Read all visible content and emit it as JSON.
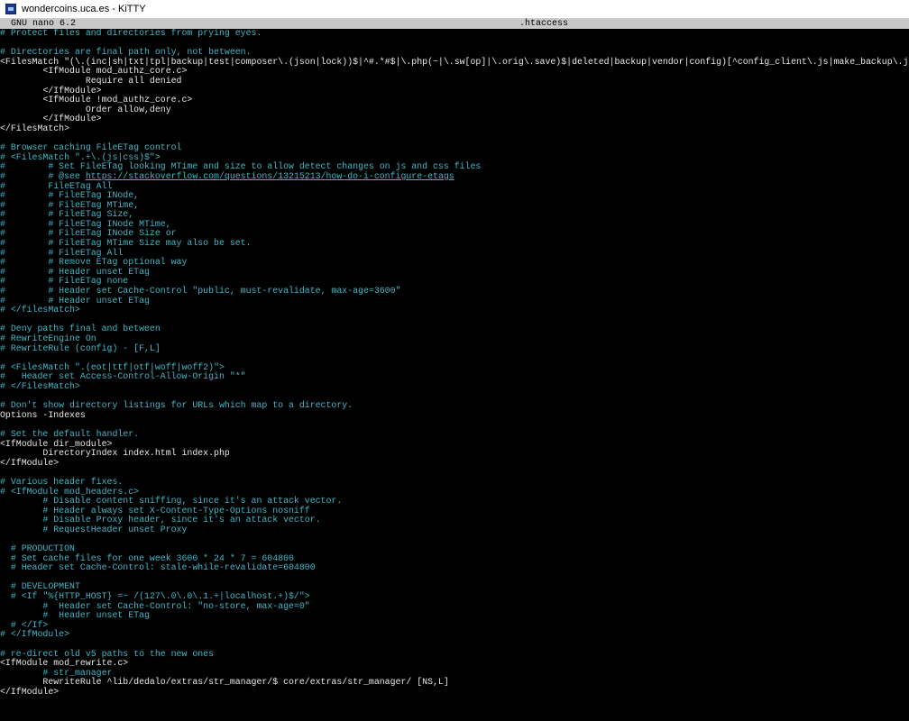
{
  "window": {
    "title": "wondercoins.uca.es - KiTTY",
    "icon": "kitty-terminal-icon"
  },
  "nano": {
    "version": "GNU nano 6.2",
    "filename": ".htaccess"
  },
  "colors": {
    "comment": "#3fb8c8",
    "text": "#e8e8e8",
    "background": "#000000",
    "header_bar": "#c8c8c8"
  },
  "editor": {
    "lines": [
      {
        "text": "# Protect files and directories from prying eyes.",
        "comment": true
      },
      {
        "text": "",
        "comment": false
      },
      {
        "text": "# Directories are final path only, not between.",
        "comment": true
      },
      {
        "text": "<FilesMatch \"(\\.(inc|sh|txt|tpl|backup|test|composer\\.(json|lock))$|^#.*#$|\\.php(~|\\.sw[op]|\\.orig\\.save)$|deleted|backup|vendor|config)[^config_client\\.js|make_backup\\.js]\">",
        "comment": false
      },
      {
        "text": "        <IfModule mod_authz_core.c>",
        "comment": false
      },
      {
        "text": "                Require all denied",
        "comment": false
      },
      {
        "text": "        </IfModule>",
        "comment": false
      },
      {
        "text": "        <IfModule !mod_authz_core.c>",
        "comment": false
      },
      {
        "text": "                Order allow,deny",
        "comment": false
      },
      {
        "text": "        </IfModule>",
        "comment": false
      },
      {
        "text": "</FilesMatch>",
        "comment": false
      },
      {
        "text": "",
        "comment": false
      },
      {
        "text": "# Browser caching FileETag control",
        "comment": true
      },
      {
        "text": "# <FilesMatch \".+\\.(js|css)$\">",
        "comment": true
      },
      {
        "text": "#        # Set FileETag looking MTime and size to allow detect changes on js and css files",
        "comment": true
      },
      {
        "text": "#        # @see ",
        "comment": true,
        "link": "https://stackoverflow.com/questions/13215213/how-do-i-configure-etags"
      },
      {
        "text": "#        FileETag All",
        "comment": true
      },
      {
        "text": "#        # FileETag INode,",
        "comment": true
      },
      {
        "text": "#        # FileETag MTime,",
        "comment": true
      },
      {
        "text": "#        # FileETag Size,",
        "comment": true
      },
      {
        "text": "#        # FileETag INode MTime,",
        "comment": true
      },
      {
        "text": "#        # FileETag INode Size or",
        "comment": true
      },
      {
        "text": "#        # FileETag MTime Size may also be set.",
        "comment": true
      },
      {
        "text": "#        # FileETag All",
        "comment": true
      },
      {
        "text": "#        # Remove ETag optional way",
        "comment": true
      },
      {
        "text": "#        # Header unset ETag",
        "comment": true
      },
      {
        "text": "#        # FileETag none",
        "comment": true
      },
      {
        "text": "#        # Header set Cache-Control \"public, must-revalidate, max-age=3600\"",
        "comment": true
      },
      {
        "text": "#        # Header unset ETag",
        "comment": true
      },
      {
        "text": "# </filesMatch>",
        "comment": true
      },
      {
        "text": "",
        "comment": false
      },
      {
        "text": "# Deny paths final and between",
        "comment": true
      },
      {
        "text": "# RewriteEngine On",
        "comment": true
      },
      {
        "text": "# RewriteRule (config) - [F,L]",
        "comment": true
      },
      {
        "text": "",
        "comment": false
      },
      {
        "text": "# <FilesMatch \".(eot|ttf|otf|woff|woff2)\">",
        "comment": true
      },
      {
        "text": "#   Header set Access-Control-Allow-Origin \"*\"",
        "comment": true
      },
      {
        "text": "# </FilesMatch>",
        "comment": true
      },
      {
        "text": "",
        "comment": false
      },
      {
        "text": "# Don't show directory listings for URLs which map to a directory.",
        "comment": true
      },
      {
        "text": "Options -Indexes",
        "comment": false
      },
      {
        "text": "",
        "comment": false
      },
      {
        "text": "# Set the default handler.",
        "comment": true
      },
      {
        "text": "<IfModule dir_module>",
        "comment": false
      },
      {
        "text": "        DirectoryIndex index.html index.php",
        "comment": false
      },
      {
        "text": "</IfModule>",
        "comment": false
      },
      {
        "text": "",
        "comment": false
      },
      {
        "text": "# Various header fixes.",
        "comment": true
      },
      {
        "text": "# <IfModule mod_headers.c>",
        "comment": true
      },
      {
        "text": "        # Disable content sniffing, since it's an attack vector.",
        "comment": true
      },
      {
        "text": "        # Header always set X-Content-Type-Options nosniff",
        "comment": true
      },
      {
        "text": "        # Disable Proxy header, since it's an attack vector.",
        "comment": true
      },
      {
        "text": "        # RequestHeader unset Proxy",
        "comment": true
      },
      {
        "text": "",
        "comment": false
      },
      {
        "text": "  # PRODUCTION",
        "comment": true
      },
      {
        "text": "  # Set cache files for one week 3600 * 24 * 7 = 604800",
        "comment": true
      },
      {
        "text": "  # Header set Cache-Control: stale-while-revalidate=604800",
        "comment": true
      },
      {
        "text": "",
        "comment": false
      },
      {
        "text": "  # DEVELOPMENT",
        "comment": true
      },
      {
        "text": "  # <If \"%{HTTP_HOST} =~ /(127\\.0\\.0\\.1.+|localhost.+)$/\">",
        "comment": true
      },
      {
        "text": "        #  Header set Cache-Control: \"no-store, max-age=0\"",
        "comment": true
      },
      {
        "text": "        #  Header unset ETag",
        "comment": true
      },
      {
        "text": "  # </If>",
        "comment": true
      },
      {
        "text": "# </IfModule>",
        "comment": true
      },
      {
        "text": "",
        "comment": false
      },
      {
        "text": "# re-direct old v5 paths to the new ones",
        "comment": true
      },
      {
        "text": "<IfModule mod_rewrite.c>",
        "comment": false
      },
      {
        "text": "        # str_manager",
        "comment": true
      },
      {
        "text": "        RewriteRule ^lib/dedalo/extras/str_manager/$ core/extras/str_manager/ [NS,L]",
        "comment": false
      },
      {
        "text": "</IfModule>",
        "comment": false
      }
    ]
  }
}
